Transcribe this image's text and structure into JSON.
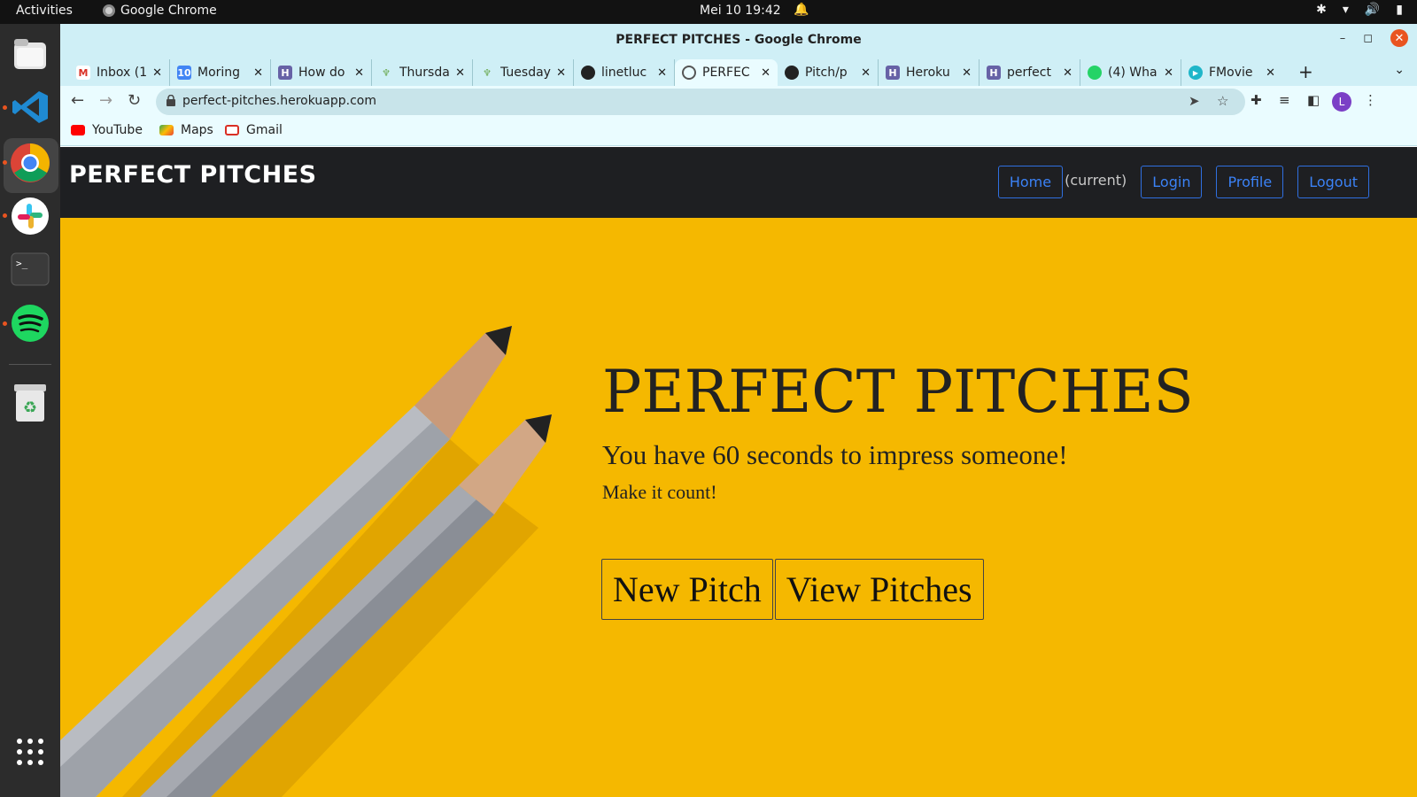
{
  "system": {
    "activities": "Activities",
    "app_name": "Google Chrome",
    "clock": "Mei 10  19:42"
  },
  "window": {
    "title": "PERFECT PITCHES - Google Chrome"
  },
  "tabs": [
    {
      "label": "Inbox (1",
      "icon": "gmail-icon",
      "color": "#d93025",
      "glyph": "M"
    },
    {
      "label": "Moring",
      "icon": "calendar-icon",
      "color": "#4285f4",
      "glyph": "10"
    },
    {
      "label": "How do",
      "icon": "heroku-icon",
      "color": "#6762a6",
      "glyph": "H"
    },
    {
      "label": "Thursda",
      "icon": "tree-icon",
      "color": "#6aa84f",
      "glyph": "♆"
    },
    {
      "label": "Tuesday",
      "icon": "tree-icon",
      "color": "#6aa84f",
      "glyph": "♆"
    },
    {
      "label": "linetluc",
      "icon": "github-icon",
      "color": "#222222",
      "glyph": "●"
    },
    {
      "label": "PERFEC",
      "icon": "globe-icon",
      "color": "#555555",
      "glyph": "◍"
    },
    {
      "label": "Pitch/p",
      "icon": "github-icon",
      "color": "#222222",
      "glyph": "●"
    },
    {
      "label": "Heroku",
      "icon": "heroku-icon",
      "color": "#6762a6",
      "glyph": "H"
    },
    {
      "label": "perfect",
      "icon": "heroku-icon",
      "color": "#6762a6",
      "glyph": "H"
    },
    {
      "label": "(4) Wha",
      "icon": "whatsapp-icon",
      "color": "#25d366",
      "glyph": "✆"
    },
    {
      "label": "FMovie",
      "icon": "play-icon",
      "color": "#1fb6c9",
      "glyph": "▶"
    }
  ],
  "address_bar": {
    "url": "perfect-pitches.herokuapp.com"
  },
  "bookmarks": [
    {
      "label": "YouTube",
      "icon": "youtube-icon",
      "color": "#ff0000"
    },
    {
      "label": "Maps",
      "icon": "maps-icon",
      "color": "#34a853"
    },
    {
      "label": "Gmail",
      "icon": "gmail-icon",
      "color": "#d93025"
    }
  ],
  "site": {
    "brand": "PERFECT PITCHES",
    "nav": {
      "home": "Home",
      "current": "(current)",
      "login": "Login",
      "profile": "Profile",
      "logout": "Logout"
    },
    "hero": {
      "title": "PERFECT PITCHES",
      "lead": "You have 60 seconds to impress someone!",
      "sub": "Make it count!",
      "new_pitch": "New Pitch",
      "view_pitches": "View Pitches"
    }
  },
  "colors": {
    "hero_bg": "#f5b800",
    "navbar_bg": "#1e1f22",
    "nav_link": "#3b82f6",
    "chrome_frame": "#cfeff6"
  }
}
